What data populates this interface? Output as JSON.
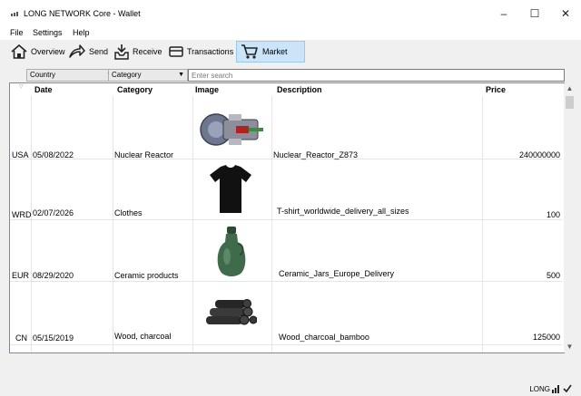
{
  "window": {
    "title": "LONG NETWORK Core - Wallet",
    "minimize": "–",
    "maximize": "☐",
    "close": "✕"
  },
  "menu": [
    {
      "label": "File"
    },
    {
      "label": "Settings"
    },
    {
      "label": "Help"
    }
  ],
  "toolbar": [
    {
      "label": "Overview",
      "icon": "home-icon"
    },
    {
      "label": "Send",
      "icon": "send-icon"
    },
    {
      "label": "Receive",
      "icon": "receive-icon"
    },
    {
      "label": "Transactions",
      "icon": "transactions-icon"
    },
    {
      "label": "Market",
      "icon": "cart-icon",
      "active": true
    }
  ],
  "filters": {
    "country": "Country",
    "category": "Category",
    "search_placeholder": "Enter search"
  },
  "table": {
    "headers": {
      "date": "Date",
      "category": "Category",
      "image": "Image",
      "description": "Description",
      "price": "Price"
    },
    "rows": [
      {
        "country": "USA",
        "date": "05/08/2022",
        "category": "Nuclear Reactor",
        "image": "nuclear-reactor-image",
        "description": "Nuclear_Reactor_Z873",
        "price": "240000000"
      },
      {
        "country": "WRD",
        "date": "02/07/2026",
        "category": "Clothes",
        "image": "tshirt-image",
        "description": "T-shirt_worldwide_delivery_all_sizes",
        "price": "100"
      },
      {
        "country": "EUR",
        "date": "08/29/2020",
        "category": "Ceramic products",
        "image": "ceramic-jar-image",
        "description": "Ceramic_Jars_Europe_Delivery",
        "price": "500"
      },
      {
        "country": "CN",
        "date": "05/15/2019",
        "category": "Wood, charcoal",
        "image": "charcoal-image",
        "description": "Wood_charcoal_bamboo",
        "price": "125000"
      }
    ]
  },
  "status": {
    "unit": "LONG",
    "sync_icon": "sync-check-icon",
    "network_icon": "network-icon"
  },
  "colors": {
    "active_tab": "#cce4f7",
    "active_tab_border": "#99c9ef"
  }
}
